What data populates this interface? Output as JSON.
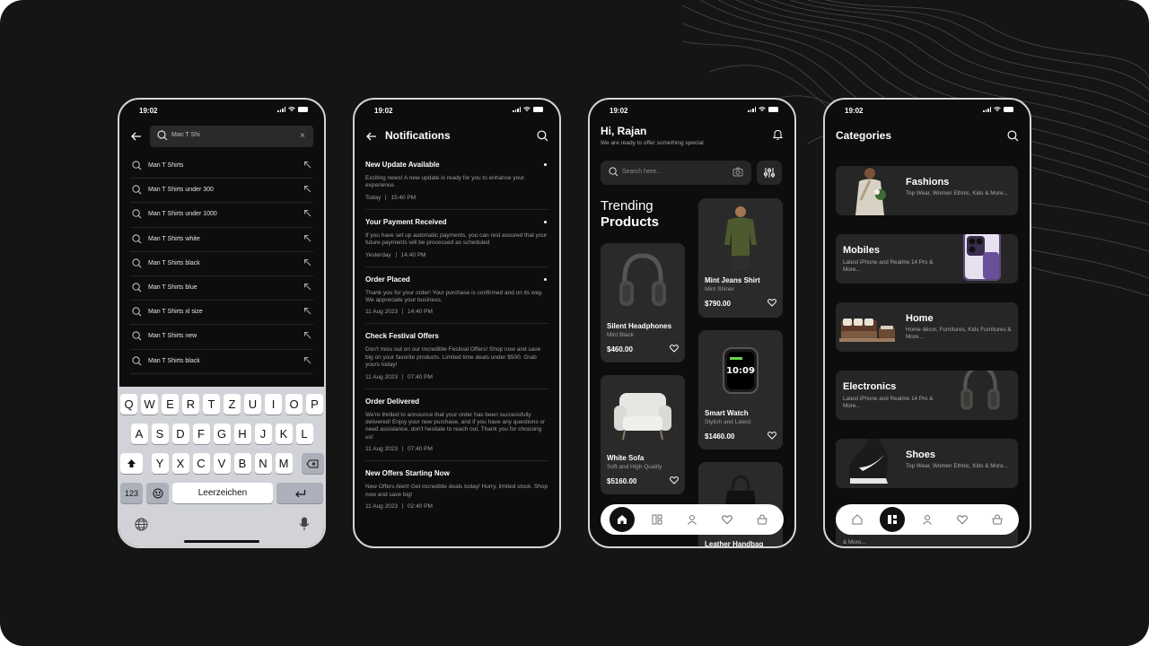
{
  "status_time": "19:02",
  "search_screen": {
    "query": "Man T Shi",
    "suggestions": [
      "Man T Shirts",
      "Man T Shirts under 300",
      "Man T Shirts under 1000",
      "Man T Shirts white",
      "Man T Shirts black",
      "Man T Shirts blue",
      "Man T Shirts xl size",
      "Man T Shirts new",
      "Man T Shirts black"
    ],
    "keyboard": {
      "row1": [
        "Q",
        "W",
        "E",
        "R",
        "T",
        "Z",
        "U",
        "I",
        "O",
        "P"
      ],
      "row2": [
        "A",
        "S",
        "D",
        "F",
        "G",
        "H",
        "J",
        "K",
        "L"
      ],
      "row3": [
        "Y",
        "X",
        "C",
        "V",
        "B",
        "N",
        "M"
      ],
      "numbers_key": "123",
      "space_key": "Leerzeichen"
    }
  },
  "notifications_screen": {
    "title": "Notifications",
    "items": [
      {
        "title": "New Update Available",
        "body": "Exciting news! A new update is ready for you to enhance your experience.",
        "date": "Today",
        "time": "15:40 PM"
      },
      {
        "title": "Your Payment Received",
        "body": "If you have set up automatic payments, you can rest assured that your future payments will be processed as scheduled",
        "date": "Yesterday",
        "time": "14:40 PM"
      },
      {
        "title": "Order Placed",
        "body": "Thank you for your order! Your purchase is confirmed and on its way. We appreciate your business.",
        "date": "11 Aug 2023",
        "time": "14:40 PM"
      },
      {
        "title": "Check Festival Offers",
        "body": "Don't miss out on our incredible Festival Offers! Shop now and save big on your favorite products. Limited time deals under $500. Grab yours today!",
        "date": "11 Aug 2023",
        "time": "07:40 PM"
      },
      {
        "title": "Order Delivered",
        "body": "We're thrilled to announce that your order has been successfully delivered! Enjoy your new purchase, and if you have any questions or need assistance, don't hesitate to reach out. Thank you for choosing us!",
        "date": "11 Aug 2023",
        "time": "07:40 PM"
      },
      {
        "title": "New Offers Starting Now",
        "body": "New Offers Alert! Get incredible deals today! Hurry, limited stock. Shop now and save big!",
        "date": "11 Aug 2023",
        "time": "02:40 PM"
      }
    ]
  },
  "home_screen": {
    "greeting": "Hi, Rajan",
    "subtitle": "We are ready to offer something special",
    "search_placeholder": "Search here...",
    "trending_line1": "Trending",
    "trending_line2": "Products",
    "products": [
      {
        "name": "Silent Headphones",
        "sub": "Mint Black",
        "price": "$460.00"
      },
      {
        "name": "Mint Jeans Shirt",
        "sub": "Mint Shiner",
        "price": "$790.00"
      },
      {
        "name": "White Sofa",
        "sub": "Soft and High Quality",
        "price": "$5160.00"
      },
      {
        "name": "Smart Watch",
        "sub": "Stylish and Latest",
        "price": "$1460.00"
      },
      {
        "name": "Leather Handbag",
        "sub": "",
        "price": ""
      }
    ]
  },
  "categories_screen": {
    "title": "Categories",
    "items": [
      {
        "name": "Fashions",
        "desc": "Top Wear, Women Ethnic, Kids & More..."
      },
      {
        "name": "Mobiles",
        "desc": "Latest iPhone and Realme 14 Pro & More..."
      },
      {
        "name": "Home",
        "desc": "Home décor, Furnitures, Kids Furnitures  & More..."
      },
      {
        "name": "Electronics",
        "desc": "Latest iPhone and Realme 14 Pro & More..."
      },
      {
        "name": "Shoes",
        "desc": "Top Wear, Women Ethnic, Kids & More..."
      },
      {
        "name": "",
        "desc": "& More..."
      }
    ]
  },
  "nav_icons": [
    "home-icon",
    "grid-icon",
    "user-icon",
    "heart-icon",
    "cart-icon"
  ]
}
